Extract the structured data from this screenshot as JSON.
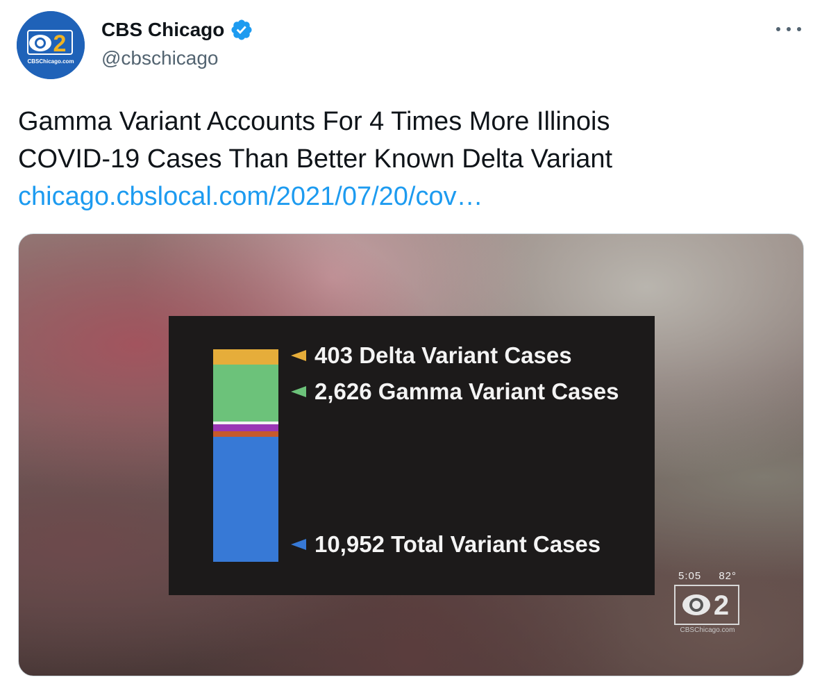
{
  "author": {
    "name": "CBS Chicago",
    "handle": "@cbschicago",
    "avatar_site_text": "CBSChicago.com",
    "logo_number": "2"
  },
  "tweet": {
    "text_line1": "Gamma Variant Accounts For 4 Times More Illinois",
    "text_line2": "COVID-19 Cases Than Better Known Delta Variant",
    "link": "chicago.cbslocal.com/2021/07/20/cov…"
  },
  "media": {
    "chart_data": {
      "type": "bar",
      "categories": [
        "Delta Variant Cases",
        "Gamma Variant Cases",
        "Total Variant Cases"
      ],
      "values": [
        403,
        2626,
        10952
      ],
      "labels": [
        "403 Delta Variant Cases",
        "2,626 Gamma Variant Cases",
        "10,952 Total Variant Cases"
      ],
      "colors": {
        "delta": "#e6ad3a",
        "gamma": "#6cc27a",
        "total": "#3779d6"
      }
    },
    "bug": {
      "time": "5:05",
      "temp": "82°",
      "site": "CBSChicago.com",
      "logo_number": "2"
    }
  },
  "icons": {
    "verified": "verified-badge-icon",
    "more": "more-options-icon"
  },
  "colors": {
    "link": "#1d9bf0",
    "verified": "#1d9bf0",
    "avatar_bg": "#1f62b8"
  }
}
